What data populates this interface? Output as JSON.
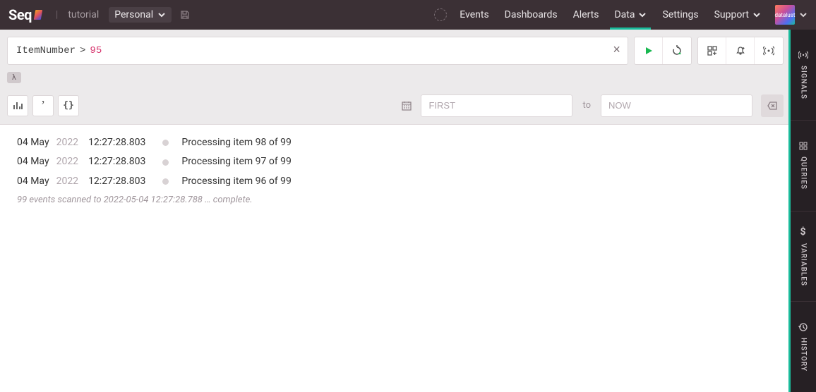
{
  "logo": {
    "text": "Seq"
  },
  "workspace": {
    "tutorial_label": "tutorial",
    "space": "Personal"
  },
  "nav": {
    "items": [
      "Events",
      "Dashboards",
      "Alerts",
      "Data",
      "Settings",
      "Support"
    ],
    "active": "Data"
  },
  "avatar": {
    "label": "datalust"
  },
  "query": {
    "field": "ItemNumber",
    "operator": ">",
    "value": "95"
  },
  "daterange": {
    "first_placeholder": "FIRST",
    "now_placeholder": "NOW",
    "to_label": "to"
  },
  "events": [
    {
      "day": "04 May",
      "year": "2022",
      "time": "12:27:28.803",
      "message_prefix": "Processing item ",
      "item": "98",
      "of_label": " of ",
      "total": "99"
    },
    {
      "day": "04 May",
      "year": "2022",
      "time": "12:27:28.803",
      "message_prefix": "Processing item ",
      "item": "97",
      "of_label": " of ",
      "total": "99"
    },
    {
      "day": "04 May",
      "year": "2022",
      "time": "12:27:28.803",
      "message_prefix": "Processing item ",
      "item": "96",
      "of_label": " of ",
      "total": "99"
    }
  ],
  "status": "99 events scanned to 2022-05-04 12:27:28.788 … complete.",
  "sidebar": {
    "items": [
      "SIGNALS",
      "QUERIES",
      "VARIABLES",
      "HISTORY"
    ]
  },
  "lambda": "λ"
}
